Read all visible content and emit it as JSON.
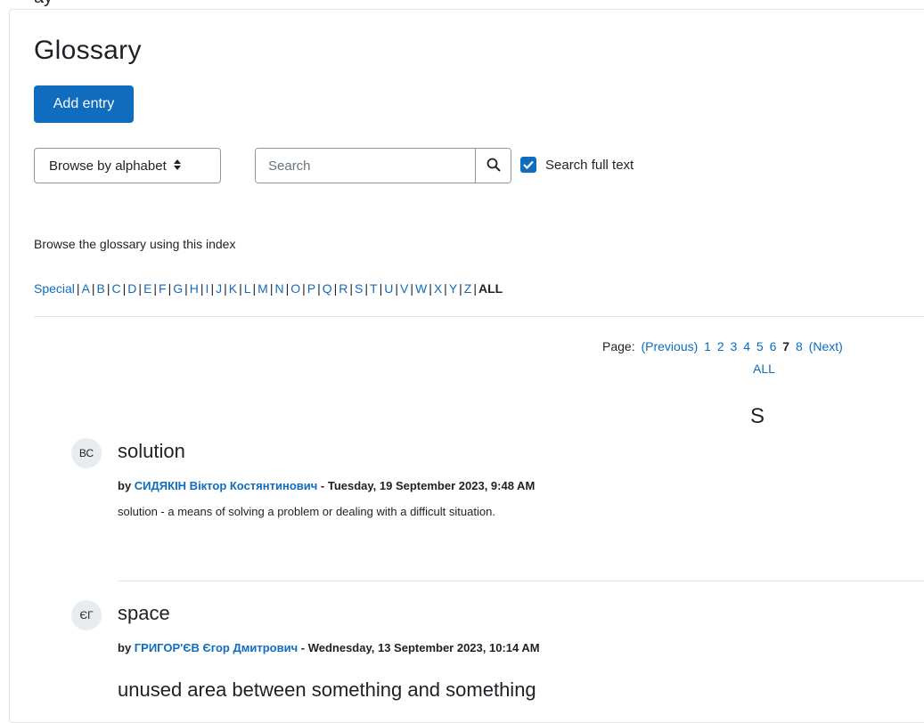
{
  "top_fragment": "ay",
  "page": {
    "title": "Glossary"
  },
  "actions": {
    "add_entry_label": "Add entry"
  },
  "browse": {
    "selected": "Browse by alphabet"
  },
  "search": {
    "placeholder": "Search",
    "value": "",
    "fulltext_label": "Search full text",
    "fulltext_checked": true
  },
  "index": {
    "label": "Browse the glossary using this index",
    "special": "Special",
    "letters": [
      "A",
      "B",
      "C",
      "D",
      "E",
      "F",
      "G",
      "H",
      "I",
      "J",
      "K",
      "L",
      "M",
      "N",
      "O",
      "P",
      "Q",
      "R",
      "S",
      "T",
      "U",
      "V",
      "W",
      "X",
      "Y",
      "Z"
    ],
    "current": "ALL"
  },
  "paging": {
    "label": "Page:",
    "previous": "(Previous)",
    "pages": [
      "1",
      "2",
      "3",
      "4",
      "5",
      "6",
      "7",
      "8"
    ],
    "current_page": "7",
    "next": "(Next)",
    "all": "ALL"
  },
  "section_letter": "S",
  "entries": [
    {
      "initials": "ВС",
      "concept": "solution",
      "by": "by",
      "author": "СИДЯКІН Віктор Костянтинович",
      "dash": " - ",
      "date": "Tuesday, 19 September 2023, 9:48 AM",
      "definition": "solution  - a means of solving a problem or dealing with a difficult situation."
    },
    {
      "initials": "ЄГ",
      "concept": "space",
      "by": "by",
      "author": "ГРИГОР'ЄВ Єгор Дмитрович",
      "dash": " - ",
      "date": "Wednesday, 13 September 2023, 10:14 AM",
      "definition": "unused area between something and something"
    }
  ],
  "icons": {
    "search": "magnifier-icon",
    "check": "check-icon",
    "caret": "sort-caret-icon"
  },
  "colors": {
    "accent": "#0f6cbf",
    "text": "#1d2125",
    "border": "#8f959e",
    "avatar_bg": "#e9ecef"
  }
}
